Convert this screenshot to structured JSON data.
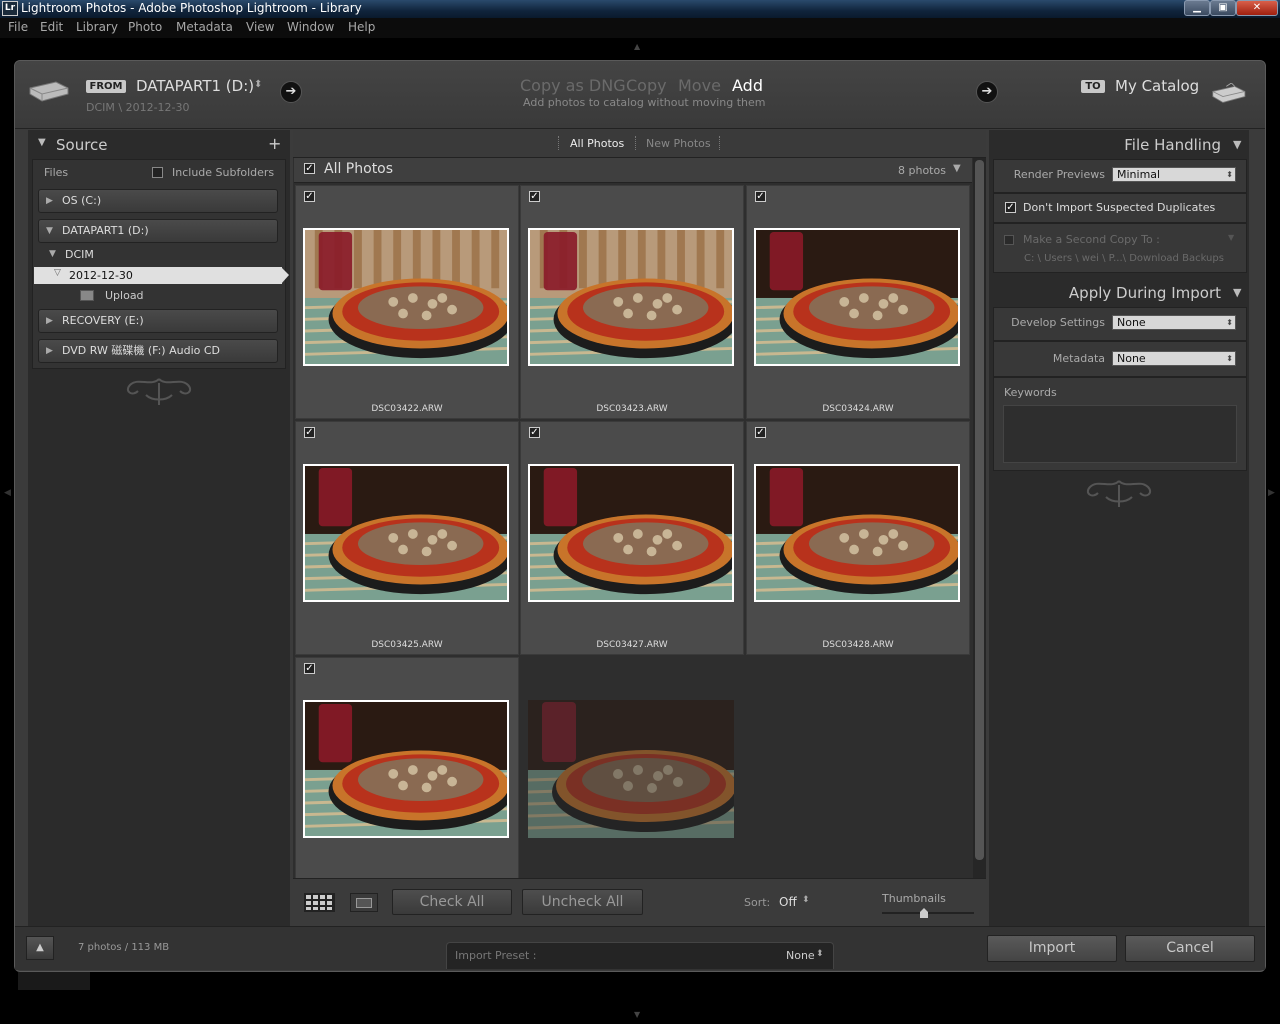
{
  "window": {
    "title": "Lightroom Photos - Adobe Photoshop Lightroom - Library",
    "app_icon": "Lr"
  },
  "menu": [
    "File",
    "Edit",
    "Library",
    "Photo",
    "Metadata",
    "View",
    "Window",
    "Help"
  ],
  "top": {
    "from_tag": "FROM",
    "from_source": "DATAPART1 (D:)",
    "from_path": "DCIM \\ 2012-12-30",
    "modes": {
      "copy_dng": "Copy as DNG",
      "copy": "Copy",
      "move": "Move",
      "add": "Add"
    },
    "mode_hint": "Add photos to catalog without moving them",
    "to_tag": "TO",
    "to_target": "My Catalog"
  },
  "source": {
    "title": "Source",
    "files_label": "Files",
    "include_subfolders": "Include Subfolders",
    "drives": {
      "os": "OS (C:)",
      "datapart": "DATAPART1 (D:)",
      "recovery": "RECOVERY (E:)",
      "dvd": "DVD RW 磁碟機 (F:) Audio CD"
    },
    "folders": {
      "dcim": "DCIM",
      "date": "2012-12-30",
      "upload": "Upload"
    }
  },
  "center": {
    "tab_all": "All Photos",
    "tab_new": "New Photos",
    "grid_title": "All Photos",
    "photo_count": "8 photos",
    "photos": [
      {
        "name": "DSC03422.ARW",
        "checked": true
      },
      {
        "name": "DSC03423.ARW",
        "checked": true
      },
      {
        "name": "DSC03424.ARW",
        "checked": true
      },
      {
        "name": "DSC03425.ARW",
        "checked": true
      },
      {
        "name": "DSC03427.ARW",
        "checked": true
      },
      {
        "name": "DSC03428.ARW",
        "checked": true
      },
      {
        "name": "",
        "checked": true
      },
      {
        "name": "",
        "checked": false
      }
    ],
    "check_all": "Check All",
    "uncheck_all": "Uncheck All",
    "sort_label": "Sort:",
    "sort_value": "Off",
    "thumbnails_label": "Thumbnails"
  },
  "file_handling": {
    "title": "File Handling",
    "render_previews_label": "Render Previews",
    "render_previews_value": "Minimal",
    "dont_import_duplicates": "Don't Import Suspected Duplicates",
    "second_copy": "Make a Second Copy To :",
    "second_copy_path": "C: \\ Users \\ wei \\ P...\\ Download Backups"
  },
  "apply_during_import": {
    "title": "Apply During Import",
    "develop_label": "Develop Settings",
    "develop_value": "None",
    "metadata_label": "Metadata",
    "metadata_value": "None",
    "keywords_label": "Keywords"
  },
  "footer": {
    "summary": "7 photos / 113 MB",
    "import_preset_label": "Import Preset :",
    "import_preset_value": "None",
    "import_button": "Import",
    "cancel_button": "Cancel"
  },
  "colors": {
    "accent_text": "#ffffff",
    "panel_bg": "#2b2b2b",
    "selected_row": "#e0e0e0"
  }
}
